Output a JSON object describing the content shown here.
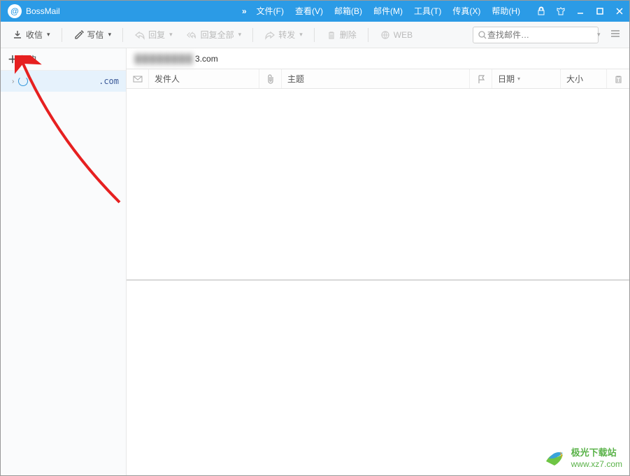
{
  "title": {
    "app_name": "BossMail"
  },
  "menubar": {
    "file": "文件(F)",
    "view": "查看(V)",
    "mailbox": "邮箱(B)",
    "mail": "邮件(M)",
    "tool": "工具(T)",
    "fax": "传真(X)",
    "help": "帮助(H)"
  },
  "toolbar": {
    "receive": "收信",
    "compose": "写信",
    "reply": "回复",
    "reply_all": "回复全部",
    "forward": "转发",
    "delete": "删除",
    "web": "WEB",
    "search_placeholder": "查找邮件…"
  },
  "sidebar": {
    "add_account": "帐户",
    "accounts": [
      {
        "label_suffix": ".com"
      }
    ]
  },
  "content": {
    "account_suffix": "3.com"
  },
  "columns": {
    "sender": "发件人",
    "subject": "主题",
    "date": "日期",
    "size": "大小"
  },
  "watermark": {
    "line1": "极光下载站",
    "line2": "www.xz7.com"
  }
}
